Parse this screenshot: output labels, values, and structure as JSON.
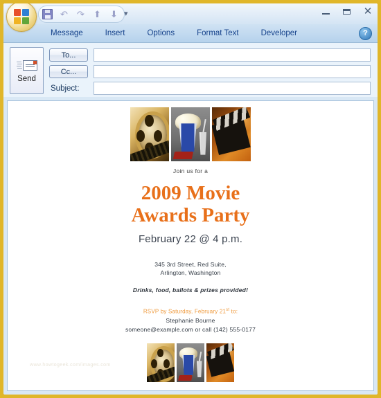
{
  "window": {
    "orb_icon": "office-orb-icon",
    "quick_access": [
      {
        "name": "save",
        "icon": "save-floppy-icon"
      },
      {
        "name": "undo",
        "icon": "undo-arrow-icon",
        "glyph": "↶"
      },
      {
        "name": "redo",
        "icon": "redo-arrow-icon",
        "glyph": "↷"
      },
      {
        "name": "previous-item",
        "icon": "up-arrow-icon",
        "glyph": "⬆"
      },
      {
        "name": "next-item",
        "icon": "down-arrow-icon",
        "glyph": "⬇"
      }
    ],
    "qat_overflow_glyph": "☰",
    "controls": {
      "minimize": "minimize-icon",
      "maximize": "maximize-icon",
      "close_glyph": "✕"
    }
  },
  "ribbon": {
    "tabs": [
      {
        "label": "Message"
      },
      {
        "label": "Insert"
      },
      {
        "label": "Options"
      },
      {
        "label": "Format Text"
      },
      {
        "label": "Developer"
      }
    ],
    "help_glyph": "?"
  },
  "compose": {
    "send_label": "Send",
    "to_label": "To...",
    "cc_label": "Cc...",
    "subject_label": "Subject:",
    "to_value": "",
    "cc_value": "",
    "subject_value": "",
    "to_placeholder": "",
    "cc_placeholder": "",
    "subject_placeholder": ""
  },
  "invitation": {
    "intro": "Join us for a",
    "title_line1": "2009 Movie",
    "title_line2": "Awards Party",
    "when": "February 22 @ 4 p.m.",
    "address_line1": "345 3rd Street, Red Suite,",
    "address_line2": "Arlington, Washington",
    "provided": "Drinks, food, ballots & prizes provided!",
    "rsvp_prefix": "RSVP by Saturday, February 21",
    "rsvp_superscript": "st",
    "rsvp_suffix": " to:",
    "host_name": "Stephanie Bourne",
    "contact": "someone@example.com or call (142) 555-0177",
    "watermark": "www.howtogeek.com/images.com",
    "images": [
      {
        "name": "film-reel-photo",
        "alt": "film reel"
      },
      {
        "name": "popcorn-drink-photo",
        "alt": "popcorn and drink"
      },
      {
        "name": "clapperboard-photo",
        "alt": "clapperboard"
      }
    ],
    "colors": {
      "title_orange": "#e8701a",
      "rsvp_orange": "#ef9a3d",
      "body_text": "#333b45",
      "window_border": "#e0b62a"
    }
  }
}
